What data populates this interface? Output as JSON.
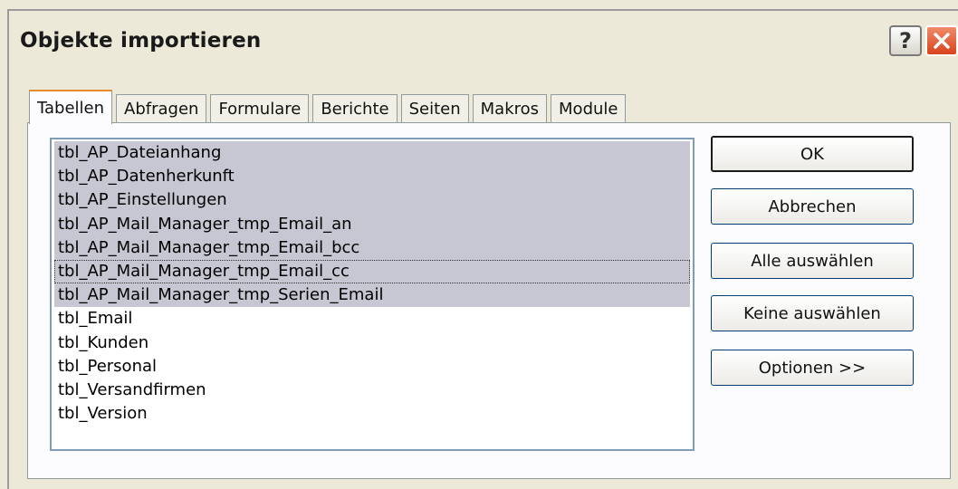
{
  "dialog": {
    "title": "Objekte importieren",
    "help_glyph": "?"
  },
  "tabs": [
    {
      "label": "Tabellen",
      "active": true
    },
    {
      "label": "Abfragen",
      "active": false
    },
    {
      "label": "Formulare",
      "active": false
    },
    {
      "label": "Berichte",
      "active": false
    },
    {
      "label": "Seiten",
      "active": false
    },
    {
      "label": "Makros",
      "active": false
    },
    {
      "label": "Module",
      "active": false
    }
  ],
  "objects": [
    {
      "name": "tbl_AP_Dateianhang",
      "selected": true
    },
    {
      "name": "tbl_AP_Datenherkunft",
      "selected": true
    },
    {
      "name": "tbl_AP_Einstellungen",
      "selected": true
    },
    {
      "name": "tbl_AP_Mail_Manager_tmp_Email_an",
      "selected": true
    },
    {
      "name": "tbl_AP_Mail_Manager_tmp_Email_bcc",
      "selected": true
    },
    {
      "name": "tbl_AP_Mail_Manager_tmp_Email_cc",
      "selected": true,
      "focused": true
    },
    {
      "name": "tbl_AP_Mail_Manager_tmp_Serien_Email",
      "selected": true
    },
    {
      "name": "tbl_Email",
      "selected": false
    },
    {
      "name": "tbl_Kunden",
      "selected": false
    },
    {
      "name": "tbl_Personal",
      "selected": false
    },
    {
      "name": "tbl_Versandfirmen",
      "selected": false
    },
    {
      "name": "tbl_Version",
      "selected": false
    }
  ],
  "buttons": {
    "ok": "OK",
    "cancel": "Abbrechen",
    "select_all": "Alle auswählen",
    "select_none": "Keine auswählen",
    "options": "Optionen >>"
  },
  "colors": {
    "selection": "#c7c7d3",
    "tab_highlight": "#e68b2c",
    "close_button": "#d8431c"
  }
}
